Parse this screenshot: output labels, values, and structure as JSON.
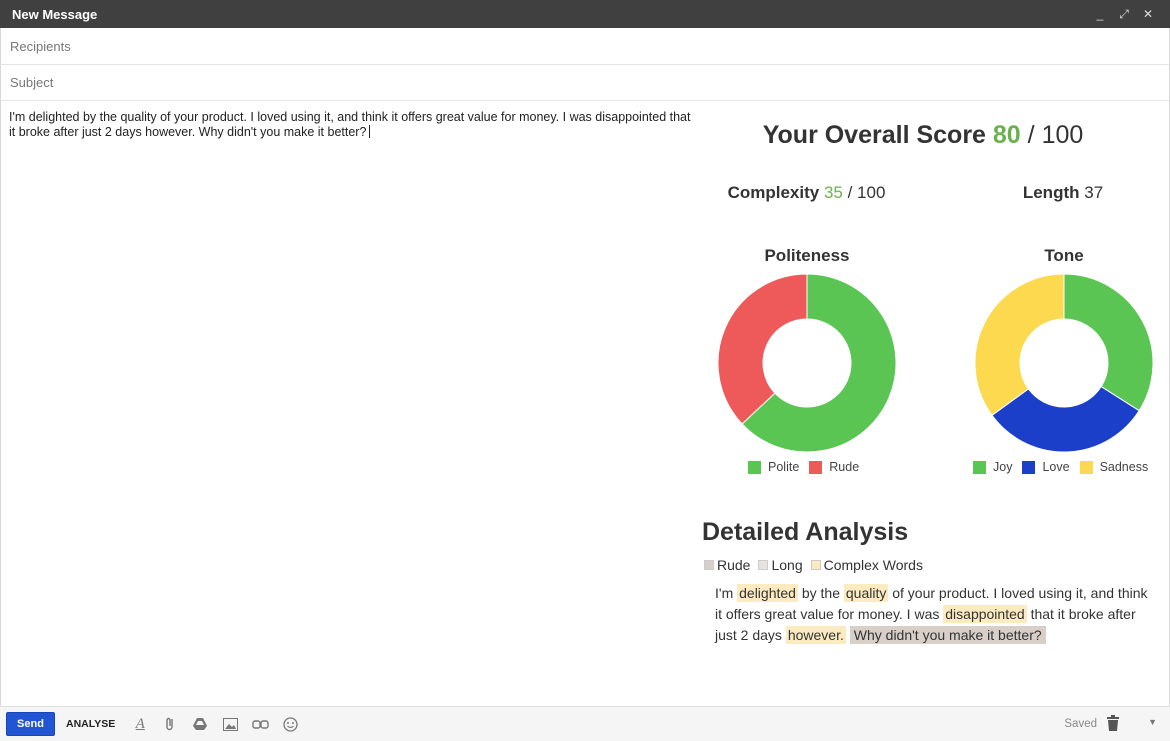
{
  "window": {
    "title": "New Message",
    "controls": [
      "_",
      "⤢",
      "✕"
    ]
  },
  "fields": {
    "recipients_placeholder": "Recipients",
    "subject_placeholder": "Subject"
  },
  "message": "I'm delighted by the quality of your product. I loved using it, and think it offers great value for money. I was disappointed that it broke after just 2 days however. Why didn't you make it better?",
  "score": {
    "overall_label": "Your Overall Score",
    "overall_value": "80",
    "overall_max": "/ 100",
    "complexity_label": "Complexity",
    "complexity_value": "35",
    "complexity_max": "/ 100",
    "length_label": "Length",
    "length_value": "37"
  },
  "politeness": {
    "title": "Politeness",
    "legend": [
      "Polite",
      "Rude"
    ]
  },
  "tone": {
    "title": "Tone",
    "legend": [
      "Joy",
      "Love",
      "Sadness"
    ]
  },
  "chart_data": [
    {
      "type": "pie",
      "title": "Politeness",
      "categories": [
        "Polite",
        "Rude"
      ],
      "values": [
        0.63,
        0.37
      ],
      "colors": [
        "#5bc553",
        "#ee5a5a"
      ]
    },
    {
      "type": "pie",
      "title": "Tone",
      "categories": [
        "Joy",
        "Love",
        "Sadness"
      ],
      "values": [
        0.34,
        0.31,
        0.35
      ],
      "colors": [
        "#5bc553",
        "#1c3fc9",
        "#fcd94f"
      ]
    }
  ],
  "detailed": {
    "title": "Detailed Analysis",
    "legend": [
      "Rude",
      "Long",
      "Complex Words"
    ],
    "segments": {
      "s1": "I'm",
      "s2": "delighted",
      "s3": "by the",
      "s4": "quality",
      "s5": "of your product. I loved using it, and think it offers great value for money. I was",
      "s6": "disappointed",
      "s7": "that it broke after just 2 days",
      "s8": "however.",
      "s9": "Why didn't you make it better?"
    }
  },
  "toolbar": {
    "send": "Send",
    "analyse": "ANALYSE",
    "saved": "Saved",
    "format_glyph": "A"
  },
  "colors": {
    "accent": "#6ab04c",
    "send": "#2255d4",
    "rude_hl": "#d8cfc9",
    "complex_hl": "#fcebc0"
  }
}
